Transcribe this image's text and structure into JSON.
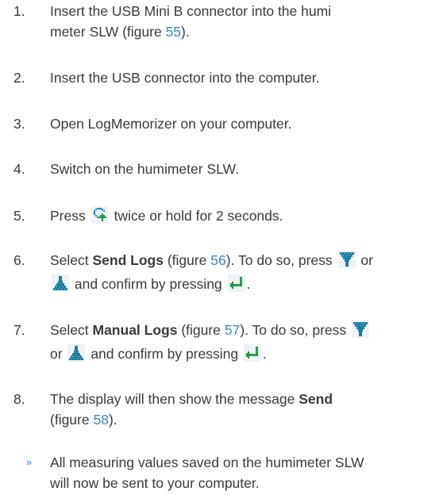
{
  "steps": [
    {
      "num": "1.",
      "t1": "Insert the USB Mini B connector into the humi",
      "t2": "meter SLW (figure ",
      "ref": "55",
      "t3": ")."
    },
    {
      "num": "2.",
      "text": "Insert the USB connector into the computer."
    },
    {
      "num": "3.",
      "text": "Open LogMemorizer on your computer."
    },
    {
      "num": "4.",
      "text": "Switch on the humimeter SLW."
    },
    {
      "num": "5.",
      "pre": "Press",
      "icon": "rotate-arrow-icon",
      "post": "twice or hold for 2 seconds."
    },
    {
      "num": "6.",
      "select": "Select ",
      "bold": "Send Logs",
      "fig_pre": " (figure ",
      "ref": "56",
      "fig_post": "). To do so, press",
      "icon_down": "down-arrow-icon",
      "or": "or",
      "icon_up": "up-arrow-icon",
      "confirm": "and confirm by pressing",
      "icon_enter": "enter-icon",
      "end": "."
    },
    {
      "num": "7.",
      "select": "Select ",
      "bold": "Manual Logs",
      "fig_pre": " (figure ",
      "ref": "57",
      "fig_post": "). To do so, press",
      "icon_down": "down-arrow-icon",
      "or": "or",
      "icon_up": "up-arrow-icon",
      "confirm": "and confirm by pressing",
      "icon_enter": "enter-icon",
      "end": "."
    },
    {
      "num": "8.",
      "pre": "The display will then show the message ",
      "bold": "Send",
      "fig_pre": "(figure ",
      "ref": "58",
      "fig_post": ")."
    }
  ],
  "result": {
    "bullet": "»",
    "line1": "All measuring values saved on the humimeter SLW",
    "line2": "will now be sent to your computer."
  },
  "colors": {
    "text": "#3a3a3a",
    "link": "#3a86c8",
    "icon_blue": "#1a7fd0",
    "icon_green": "#1f9a3a"
  }
}
